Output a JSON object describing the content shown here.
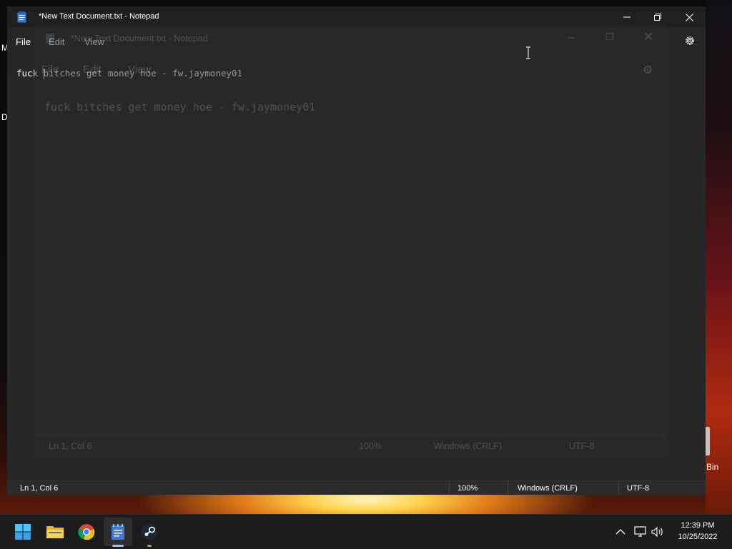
{
  "desktop": {
    "partial_left_1": "M",
    "partial_left_2": "D",
    "recycle_bin_label": "Bin"
  },
  "window": {
    "title": "*New Text Document.txt - Notepad",
    "menu": {
      "file": "File",
      "edit": "Edit",
      "view": "View"
    },
    "document_text": "fuck bitches get money hoe - fw.jaymoney01",
    "status": {
      "position": "Ln 1, Col 6",
      "zoom": "100%",
      "line_endings": "Windows (CRLF)",
      "encoding": "UTF-8"
    }
  },
  "ghost_window": {
    "title": "*New Text Document.txt - Notepad",
    "menu": {
      "file": "File",
      "edit": "Edit",
      "view": "View"
    },
    "document_text": "fuck bitches get money hoe - fw.jaymoney01",
    "status": {
      "position": "Ln 1, Col 6",
      "zoom": "100%",
      "line_endings": "Windows (CRLF)",
      "encoding": "UTF-8"
    }
  },
  "taskbar": {
    "apps": [
      "start-icon",
      "file-explorer-icon",
      "chrome-icon",
      "notepad-icon",
      "steam-icon"
    ],
    "time": "12:39 PM",
    "date": "10/25/2022"
  },
  "colors": {
    "accent": "#9bb8ff",
    "window_bg": "#272727",
    "titlebar_bg": "#202020",
    "taskbar_bg": "#1c1c1c"
  }
}
